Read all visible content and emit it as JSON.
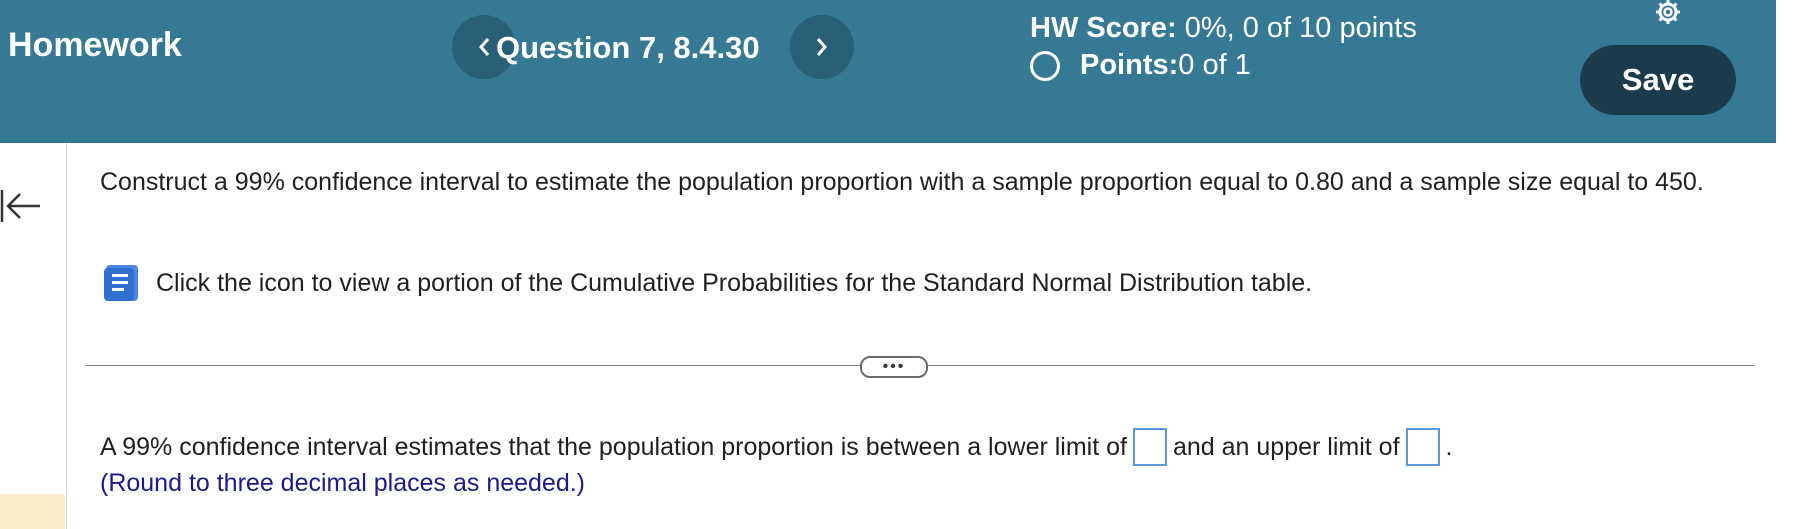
{
  "header": {
    "title": "Homework",
    "question_label": "Question 7, 8.4.30",
    "hw_score_label": "HW Score:",
    "hw_score_value": " 0%, 0 of 10 points",
    "points_label": "Points:",
    "points_value": " 0 of 1",
    "save_label": "Save",
    "prev_glyph": "<",
    "next_glyph": ">"
  },
  "question": {
    "text": "Construct a 99% confidence interval to estimate the population proportion with a sample proportion equal to 0.80 and a sample size equal to 450.",
    "table_link_text": "Click the icon to view a portion of the Cumulative Probabilities for the Standard Normal Distribution table."
  },
  "expand": {
    "glyph": "•••"
  },
  "answer": {
    "prefix": "A 99% confidence interval estimates that the population proportion is between a lower limit of",
    "middle": "and an upper limit of",
    "suffix": ".",
    "lower_value": "",
    "upper_value": "",
    "round_note": "(Round to three decimal places as needed.)"
  },
  "colors": {
    "header_bg": "#367994",
    "save_bg": "#1b3b4d",
    "note_text": "#1a1a8c",
    "answer_box_border": "#5b9bd5"
  },
  "icons": [
    "chevron-left-icon",
    "chevron-right-icon",
    "circle-icon",
    "gear-icon",
    "back-arrow-icon",
    "book-icon"
  ]
}
